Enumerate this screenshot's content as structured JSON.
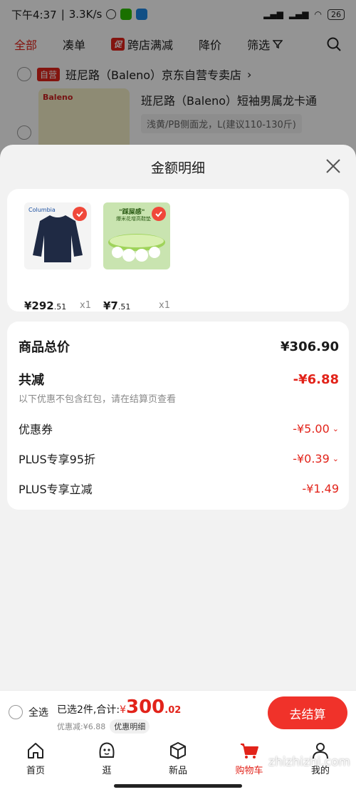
{
  "status_bar": {
    "time": "下午4:37",
    "speed": "3.3K/s",
    "battery": "26"
  },
  "top_tabs": [
    {
      "label": "全部"
    },
    {
      "label": "凑单"
    },
    {
      "label": "跨店满减",
      "badge": "促"
    },
    {
      "label": "降价"
    },
    {
      "label": "筛选"
    }
  ],
  "background_store": {
    "tag": "自营",
    "name": "班尼路（Baleno）京东自营专卖店",
    "arrow": "›"
  },
  "background_product": {
    "brand": "Baleno",
    "title": "班尼路（Baleno）短袖男属龙卡通",
    "spec": "浅黄/PB侧面龙，L(建议110-130斤)"
  },
  "sheet": {
    "title": "金额明细"
  },
  "items": [
    {
      "price_int": "¥292",
      "price_dec": ".51",
      "qty": "x1",
      "brand": "Columbia"
    },
    {
      "price_int": "¥7",
      "price_dec": ".51",
      "qty": "x1",
      "tag": "\"踩屎感\"",
      "desc": "爆米花增高鞋垫"
    }
  ],
  "summary": {
    "total_label": "商品总价",
    "total_value": "¥306.90",
    "reduce_label": "共减",
    "reduce_value": "-¥6.88",
    "hint": "以下优惠不包含红包，请在结算页查看",
    "coupon_label": "优惠券",
    "coupon_value": "-¥5.00",
    "plus95_label": "PLUS专享95折",
    "plus95_value": "-¥0.39",
    "plus_cut_label": "PLUS专享立减",
    "plus_cut_value": "-¥1.49"
  },
  "checkout": {
    "select_all": "全选",
    "selected_text": "已选2件,合计:",
    "currency": "¥",
    "amount_int": "300",
    "amount_dec": ".02",
    "discount_text": "优惠减:¥6.88",
    "detail_chip": "优惠明细",
    "button": "去结算"
  },
  "tab_bar": [
    {
      "label": "首页"
    },
    {
      "label": "逛"
    },
    {
      "label": "新品"
    },
    {
      "label": "购物车"
    },
    {
      "label": "我的"
    }
  ],
  "watermark": "zhizhizhi.com",
  "colors": {
    "accent": "#e2231a",
    "button": "#f0322a"
  }
}
